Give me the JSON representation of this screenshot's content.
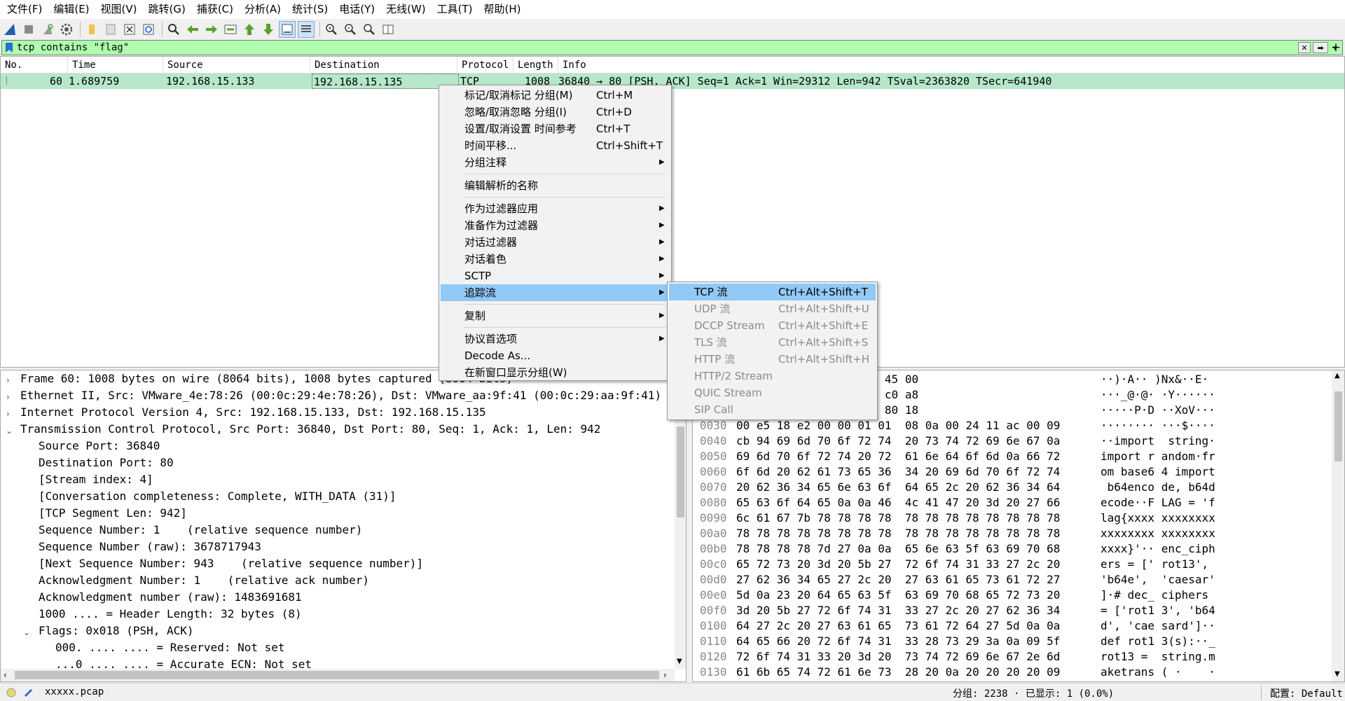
{
  "menubar": [
    "文件(F)",
    "编辑(E)",
    "视图(V)",
    "跳转(G)",
    "捕获(C)",
    "分析(A)",
    "统计(S)",
    "电话(Y)",
    "无线(W)",
    "工具(T)",
    "帮助(H)"
  ],
  "toolbar": {
    "icons": [
      "shark-fin-start-icon",
      "stop-icon",
      "restart-icon",
      "options-gear-icon",
      "open-folder-icon",
      "save-file-icon",
      "close-file-icon",
      "reload-icon",
      "find-icon",
      "back-arrow-icon",
      "forward-arrow-icon",
      "goto-packet-icon",
      "first-packet-icon",
      "last-packet-icon",
      "autoscroll-icon",
      "colorize-icon",
      "zoom-in-icon",
      "zoom-out-icon",
      "zoom-normal-icon",
      "resize-columns-icon"
    ]
  },
  "filter": {
    "value": "tcp contains \"flag\"",
    "add_label": "+"
  },
  "packet_list": {
    "columns": [
      "No.",
      "Time",
      "Source",
      "Destination",
      "Protocol",
      "Length",
      "Info"
    ],
    "row": {
      "no": "60",
      "time": "1.689759",
      "source": "192.168.15.133",
      "destination": "192.168.15.135",
      "protocol": "TCP",
      "length": "1008",
      "info": "36840 → 80 [PSH, ACK] Seq=1 Ack=1 Win=29312 Len=942 TSval=2363820 TSecr=641940"
    }
  },
  "details": [
    "Frame 60: 1008 bytes on wire (8064 bits), 1008 bytes captured (8064 bits)",
    "Ethernet II, Src: VMware_4e:78:26 (00:0c:29:4e:78:26), Dst: VMware_aa:9f:41 (00:0c:29:aa:9f:41)",
    "Internet Protocol Version 4, Src: 192.168.15.133, Dst: 192.168.15.135",
    "Transmission Control Protocol, Src Port: 36840, Dst Port: 80, Seq: 1, Ack: 1, Len: 942",
    "Source Port: 36840",
    "Destination Port: 80",
    "[Stream index: 4]",
    "[Conversation completeness: Complete, WITH_DATA (31)]",
    "[TCP Segment Len: 942]",
    "Sequence Number: 1    (relative sequence number)",
    "Sequence Number (raw): 3678717943",
    "[Next Sequence Number: 943    (relative sequence number)]",
    "Acknowledgment Number: 1    (relative ack number)",
    "Acknowledgment number (raw): 1483691681",
    "1000 .... = Header Length: 32 bytes (8)",
    "Flags: 0x018 (PSH, ACK)",
    "000. .... .... = Reserved: Not set",
    "...0 .... .... = Accurate ECN: Not set"
  ],
  "bytes": [
    {
      "off": "",
      "hex": "0c  29 4e 78 26 08 00 45 00",
      "ascii": "··)·A·· )Nx&··E·"
    },
    {
      "off": "",
      "hex": "06  c0 59 c0 a8 0f 85 c0 a8",
      "ascii": "···_@·@· ·Y······"
    },
    {
      "off": "",
      "hex": "44  c7 f7 58 6f 56 a1 80 18",
      "ascii": "·····P·D ··XoV···"
    },
    {
      "off": "0030",
      "hex": "00 e5 18 e2 00 00 01 01  08 0a 00 24 11 ac 00 09",
      "ascii": "········ ···$····"
    },
    {
      "off": "0040",
      "hex": "cb 94 69 6d 70 6f 72 74  20 73 74 72 69 6e 67 0a",
      "ascii": "··import  string·"
    },
    {
      "off": "0050",
      "hex": "69 6d 70 6f 72 74 20 72  61 6e 64 6f 6d 0a 66 72",
      "ascii": "import r andom·fr"
    },
    {
      "off": "0060",
      "hex": "6f 6d 20 62 61 73 65 36  34 20 69 6d 70 6f 72 74",
      "ascii": "om base6 4 import"
    },
    {
      "off": "0070",
      "hex": "20 62 36 34 65 6e 63 6f  64 65 2c 20 62 36 34 64",
      "ascii": " b64enco de, b64d"
    },
    {
      "off": "0080",
      "hex": "65 63 6f 64 65 0a 0a 46  4c 41 47 20 3d 20 27 66",
      "ascii": "ecode··F LAG = 'f"
    },
    {
      "off": "0090",
      "hex": "6c 61 67 7b 78 78 78 78  78 78 78 78 78 78 78 78",
      "ascii": "lag{xxxx xxxxxxxx"
    },
    {
      "off": "00a0",
      "hex": "78 78 78 78 78 78 78 78  78 78 78 78 78 78 78 78",
      "ascii": "xxxxxxxx xxxxxxxx"
    },
    {
      "off": "00b0",
      "hex": "78 78 78 78 7d 27 0a 0a  65 6e 63 5f 63 69 70 68",
      "ascii": "xxxx}'·· enc_ciph"
    },
    {
      "off": "00c0",
      "hex": "65 72 73 20 3d 20 5b 27  72 6f 74 31 33 27 2c 20",
      "ascii": "ers = [' rot13', "
    },
    {
      "off": "00d0",
      "hex": "27 62 36 34 65 27 2c 20  27 63 61 65 73 61 72 27",
      "ascii": "'b64e',  'caesar'"
    },
    {
      "off": "00e0",
      "hex": "5d 0a 23 20 64 65 63 5f  63 69 70 68 65 72 73 20",
      "ascii": "]·# dec_ ciphers "
    },
    {
      "off": "00f0",
      "hex": "3d 20 5b 27 72 6f 74 31  33 27 2c 20 27 62 36 34",
      "ascii": "= ['rot1 3', 'b64"
    },
    {
      "off": "0100",
      "hex": "64 27 2c 20 27 63 61 65  73 61 72 64 27 5d 0a 0a",
      "ascii": "d', 'cae sard']··"
    },
    {
      "off": "0110",
      "hex": "64 65 66 20 72 6f 74 31  33 28 73 29 3a 0a 09 5f",
      "ascii": "def rot1 3(s):··_"
    },
    {
      "off": "0120",
      "hex": "72 6f 74 31 33 20 3d 20  73 74 72 69 6e 67 2e 6d",
      "ascii": "rot13 =  string.m"
    },
    {
      "off": "0130",
      "hex": "61 6b 65 74 72 61 6e 73  28 20 0a 20 20 20 20 09",
      "ascii": "aketrans ( ·    ·"
    }
  ],
  "status": {
    "file": "xxxxx.pcap",
    "packets": "分组: 2238 · 已显示: 1 (0.0%)",
    "profile": "配置: Default"
  },
  "context_menu": [
    {
      "label": "标记/取消标记 分组(M)",
      "shortcut": "Ctrl+M"
    },
    {
      "label": "忽略/取消忽略 分组(I)",
      "shortcut": "Ctrl+D"
    },
    {
      "label": "设置/取消设置 时间参考",
      "shortcut": "Ctrl+T"
    },
    {
      "label": "时间平移...",
      "shortcut": "Ctrl+Shift+T"
    },
    {
      "label": "分组注释",
      "submenu": true
    },
    {
      "sep": true
    },
    {
      "label": "编辑解析的名称"
    },
    {
      "sep": true
    },
    {
      "label": "作为过滤器应用",
      "submenu": true
    },
    {
      "label": "准备作为过滤器",
      "submenu": true
    },
    {
      "label": "对话过滤器",
      "submenu": true
    },
    {
      "label": "对话着色",
      "submenu": true
    },
    {
      "label": "SCTP",
      "submenu": true
    },
    {
      "label": "追踪流",
      "submenu": true,
      "highlighted": true
    },
    {
      "sep": true
    },
    {
      "label": "复制",
      "submenu": true
    },
    {
      "sep": true
    },
    {
      "label": "协议首选项",
      "submenu": true
    },
    {
      "label": "Decode As..."
    },
    {
      "label": "在新窗口显示分组(W)"
    }
  ],
  "submenu": [
    {
      "label": "TCP 流",
      "shortcut": "Ctrl+Alt+Shift+T",
      "highlighted": true
    },
    {
      "label": "UDP 流",
      "shortcut": "Ctrl+Alt+Shift+U",
      "disabled": true
    },
    {
      "label": "DCCP Stream",
      "shortcut": "Ctrl+Alt+Shift+E",
      "disabled": true
    },
    {
      "label": "TLS 流",
      "shortcut": "Ctrl+Alt+Shift+S",
      "disabled": true
    },
    {
      "label": "HTTP 流",
      "shortcut": "Ctrl+Alt+Shift+H",
      "disabled": true
    },
    {
      "label": "HTTP/2 Stream",
      "disabled": true
    },
    {
      "label": "QUIC Stream",
      "disabled": true
    },
    {
      "label": "SIP Call",
      "disabled": true
    }
  ],
  "colors": {
    "filter_bg": "#afffaf",
    "row_bg": "#b6e7c9",
    "highlight": "#91c9f7"
  }
}
